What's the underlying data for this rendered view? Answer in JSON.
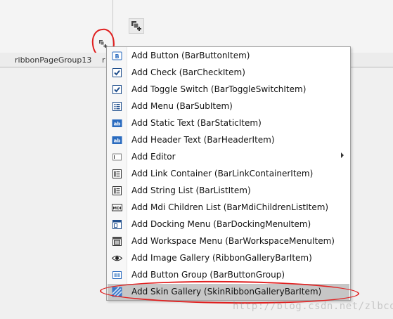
{
  "designer": {
    "group_label": "ribbonPageGroup13",
    "group_label_cut": "r"
  },
  "context_menu": {
    "items": [
      {
        "label": "Add Button (BarButtonItem)",
        "icon": "button-icon",
        "submenu": false
      },
      {
        "label": "Add Check (BarCheckItem)",
        "icon": "checkbox-icon",
        "submenu": false
      },
      {
        "label": "Add Toggle Switch (BarToggleSwitchItem)",
        "icon": "checkbox-icon",
        "submenu": false
      },
      {
        "label": "Add Menu (BarSubItem)",
        "icon": "menu-icon",
        "submenu": false
      },
      {
        "label": "Add Static Text (BarStaticItem)",
        "icon": "static-text-icon",
        "submenu": false
      },
      {
        "label": "Add Header Text (BarHeaderItem)",
        "icon": "static-text-icon",
        "submenu": false
      },
      {
        "label": "Add Editor",
        "icon": "editor-icon",
        "submenu": true
      },
      {
        "label": "Add Link Container (BarLinkContainerItem)",
        "icon": "list-icon",
        "submenu": false
      },
      {
        "label": "Add String List (BarListItem)",
        "icon": "list-icon",
        "submenu": false
      },
      {
        "label": "Add Mdi Children List (BarMdiChildrenListItem)",
        "icon": "mdi-icon",
        "submenu": false
      },
      {
        "label": "Add Docking Menu (BarDockingMenuItem)",
        "icon": "docking-icon",
        "submenu": false
      },
      {
        "label": "Add Workspace Menu (BarWorkspaceMenuItem)",
        "icon": "workspace-icon",
        "submenu": false
      },
      {
        "label": "Add Image Gallery (RibbonGalleryBarItem)",
        "icon": "eye-icon",
        "submenu": false
      },
      {
        "label": "Add Button Group (BarButtonGroup)",
        "icon": "button-group-icon",
        "submenu": false
      },
      {
        "label": "Add Skin Gallery (SkinRibbonGalleryBarItem)",
        "icon": "skin-icon",
        "submenu": false,
        "highlighted": true
      }
    ]
  },
  "watermark": "http://blog.csdn.net/zlbcdn",
  "colors": {
    "annotation_red": "#e02020",
    "icon_blue": "#1f5fa8",
    "highlight": "#c6c6c6"
  }
}
